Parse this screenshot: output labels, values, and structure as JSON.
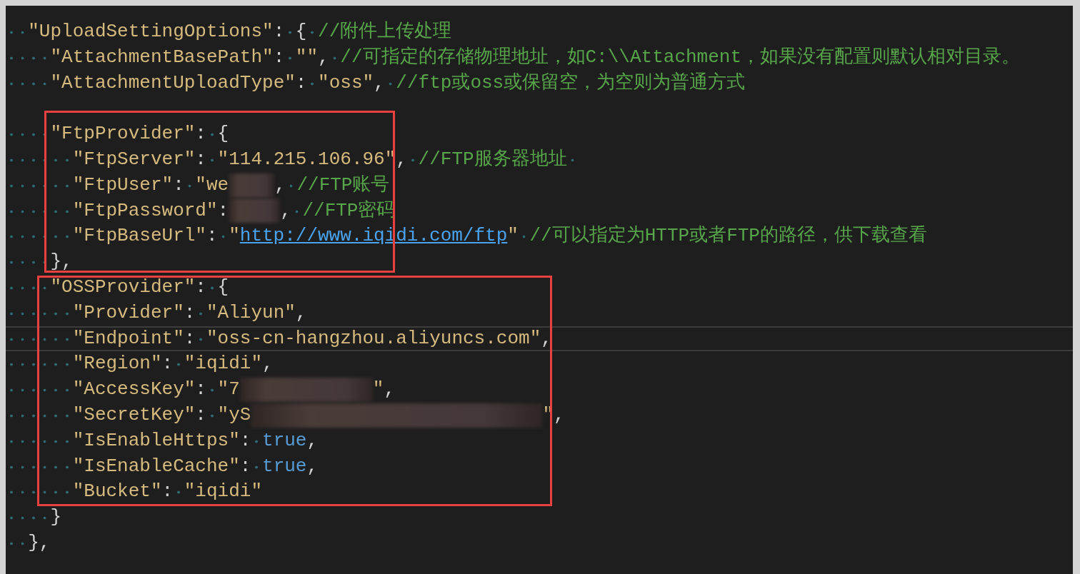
{
  "editor": {
    "blocks": [
      {
        "boxed": false,
        "lines": [
          {
            "current": false,
            "tokens": [
              {
                "kind": "key",
                "text": "  \"UploadSettingOptions\""
              },
              {
                "kind": "punct",
                "text": ": { "
              },
              {
                "kind": "comment",
                "text": "//附件上传处理"
              }
            ]
          },
          {
            "current": false,
            "tokens": [
              {
                "kind": "key",
                "text": "    \"AttachmentBasePath\""
              },
              {
                "kind": "punct",
                "text": ": "
              },
              {
                "kind": "string",
                "text": "\"\""
              },
              {
                "kind": "punct",
                "text": ", "
              },
              {
                "kind": "comment",
                "text": "//可指定的存储物理地址，如C:\\\\Attachment，如果没有配置则默认相对目录。"
              }
            ]
          },
          {
            "current": false,
            "tokens": [
              {
                "kind": "key",
                "text": "    \"AttachmentUploadType\""
              },
              {
                "kind": "punct",
                "text": ": "
              },
              {
                "kind": "string",
                "text": "\"oss\""
              },
              {
                "kind": "punct",
                "text": ", "
              },
              {
                "kind": "comment",
                "text": "//ftp或oss或保留空，为空则为普通方式"
              }
            ]
          }
        ]
      },
      {
        "boxed": true,
        "lines": [
          {
            "current": false
          },
          {
            "current": false,
            "tokens": [
              {
                "kind": "key",
                "text": "    \"FtpProvider\""
              },
              {
                "kind": "punct",
                "text": ": {"
              }
            ]
          },
          {
            "current": false,
            "tokens": [
              {
                "kind": "key",
                "text": "      \"FtpServer\""
              },
              {
                "kind": "punct",
                "text": ": "
              },
              {
                "kind": "string",
                "text": "\"114.215.106.96\""
              },
              {
                "kind": "punct",
                "text": ", "
              },
              {
                "kind": "comment",
                "text": "//FTP服务器地址 "
              }
            ]
          },
          {
            "current": false,
            "tokens": [
              {
                "kind": "key",
                "text": "      \"FtpUser\""
              },
              {
                "kind": "punct",
                "text": ": "
              },
              {
                "kind": "string",
                "text": "\"we"
              },
              {
                "kind": "redacted"
              },
              {
                "kind": "punct",
                "text": ", "
              },
              {
                "kind": "comment",
                "text": "//FTP账号"
              }
            ]
          },
          {
            "current": false,
            "tokens": [
              {
                "kind": "key",
                "text": "      \"FtpPassword\""
              },
              {
                "kind": "punct",
                "text": ":"
              },
              {
                "kind": "redacted"
              },
              {
                "kind": "punct",
                "text": ", "
              },
              {
                "kind": "comment",
                "text": "//FTP密码"
              }
            ]
          },
          {
            "current": false,
            "tokens": [
              {
                "kind": "key",
                "text": "      \"FtpBaseUrl\""
              },
              {
                "kind": "punct",
                "text": ": "
              },
              {
                "kind": "string",
                "text": "\""
              },
              {
                "kind": "link",
                "text": "http://www.iqidi.com/ftp"
              },
              {
                "kind": "string",
                "text": "\""
              },
              {
                "kind": "comment",
                "text": " //可以指定为HTTP或者FTP的路径，供下载查看"
              }
            ]
          },
          {
            "current": false,
            "tokens": [
              {
                "kind": "punct",
                "text": "    },"
              }
            ]
          }
        ]
      },
      {
        "boxed": true,
        "lines": [
          {
            "current": false,
            "tokens": [
              {
                "kind": "key",
                "text": "    \"OSSProvider\""
              },
              {
                "kind": "punct",
                "text": ": {"
              }
            ]
          },
          {
            "current": false,
            "tokens": [
              {
                "kind": "key",
                "text": "      \"Provider\""
              },
              {
                "kind": "punct",
                "text": ": "
              },
              {
                "kind": "string",
                "text": "\"Aliyun\""
              },
              {
                "kind": "punct",
                "text": ","
              }
            ]
          },
          {
            "current": true,
            "tokens": [
              {
                "kind": "key",
                "text": "      \"Endpoint\""
              },
              {
                "kind": "punct",
                "text": ": "
              },
              {
                "kind": "string",
                "text": "\"oss-cn-hangzhou.aliyuncs.com\""
              },
              {
                "kind": "punct",
                "text": ","
              }
            ]
          },
          {
            "current": false,
            "tokens": [
              {
                "kind": "key",
                "text": "      \"Region\""
              },
              {
                "kind": "punct",
                "text": ": "
              },
              {
                "kind": "string",
                "text": "\"iqidi\""
              },
              {
                "kind": "punct",
                "text": ","
              }
            ]
          },
          {
            "current": false,
            "tokens": [
              {
                "kind": "key",
                "text": "      \"AccessKey\""
              },
              {
                "kind": "punct",
                "text": ": "
              },
              {
                "kind": "string",
                "text": "\"7"
              },
              {
                "kind": "redacted"
              },
              {
                "kind": "string",
                "text": "\""
              },
              {
                "kind": "punct",
                "text": ","
              }
            ]
          },
          {
            "current": false,
            "tokens": [
              {
                "kind": "key",
                "text": "      \"SecretKey\""
              },
              {
                "kind": "punct",
                "text": ": "
              },
              {
                "kind": "string",
                "text": "\"yS"
              },
              {
                "kind": "redacted"
              },
              {
                "kind": "string",
                "text": "\""
              },
              {
                "kind": "punct",
                "text": ","
              }
            ]
          },
          {
            "current": false,
            "tokens": [
              {
                "kind": "key",
                "text": "      \"IsEnableHttps\""
              },
              {
                "kind": "punct",
                "text": ": "
              },
              {
                "kind": "bool",
                "text": "true"
              },
              {
                "kind": "punct",
                "text": ","
              }
            ]
          },
          {
            "current": false,
            "tokens": [
              {
                "kind": "key",
                "text": "      \"IsEnableCache\""
              },
              {
                "kind": "punct",
                "text": ": "
              },
              {
                "kind": "bool",
                "text": "true"
              },
              {
                "kind": "punct",
                "text": ","
              }
            ]
          },
          {
            "current": false,
            "tokens": [
              {
                "kind": "key",
                "text": "      \"Bucket\""
              },
              {
                "kind": "punct",
                "text": ": "
              },
              {
                "kind": "string",
                "text": "\"iqidi\""
              }
            ]
          }
        ]
      },
      {
        "boxed": false,
        "lines": [
          {
            "current": false,
            "tokens": [
              {
                "kind": "punct",
                "text": "    }"
              }
            ]
          },
          {
            "current": false,
            "tokens": [
              {
                "kind": "punct",
                "text": "  },"
              }
            ]
          }
        ]
      }
    ]
  }
}
